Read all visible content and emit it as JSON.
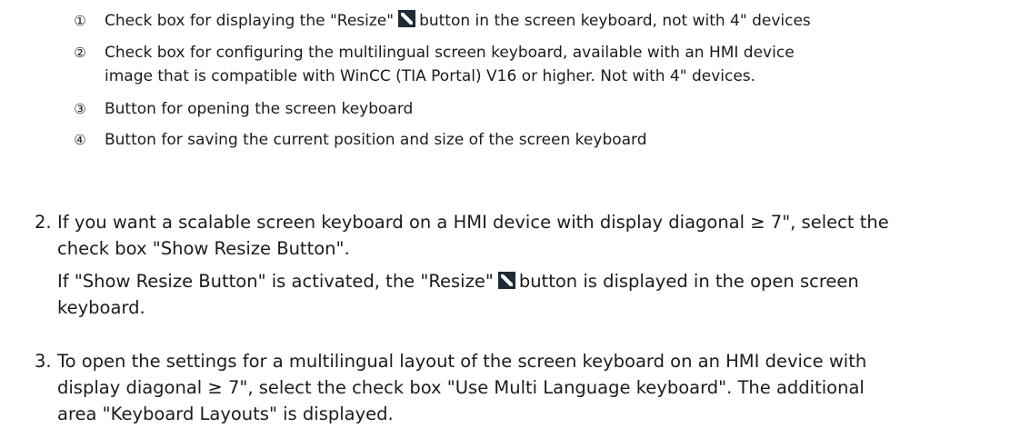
{
  "legend": [
    {
      "num": "①",
      "lines": [
        "Check box for displaying the \"Resize\"",
        "button in the screen keyboard, not with 4\" devices"
      ]
    },
    {
      "num": "②",
      "lines": [
        "Check box for configuring the multilingual screen keyboard, available with an HMI device",
        "image that is compatible with WinCC (TIA Portal) V16 or higher. Not with 4\" devices."
      ]
    },
    {
      "num": "③",
      "lines": [
        "Button for opening the screen keyboard"
      ]
    },
    {
      "num": "④",
      "lines": [
        "Button for saving the current position and size of the screen keyboard"
      ]
    }
  ],
  "steps": [
    {
      "num": "2.",
      "lines": [
        "If you want a scalable screen keyboard on a HMI device with display diagonal ≥ 7\", select the",
        "check box \"Show Resize Button\"."
      ],
      "extra_before_icon": "If \"Show Resize Button\" is activated, the \"Resize\"",
      "extra_after_icon": "button is displayed in the open screen",
      "extra_line2": "keyboard."
    },
    {
      "num": "3.",
      "lines": [
        "To open the settings for a multilingual layout of the screen keyboard on an HMI device with",
        "display diagonal ≥ 7\", select the check box \"Use Multi Language keyboard\". The additional",
        "area \"Keyboard Layouts\" is displayed."
      ]
    }
  ],
  "icons": {
    "resize": "resize-icon"
  }
}
